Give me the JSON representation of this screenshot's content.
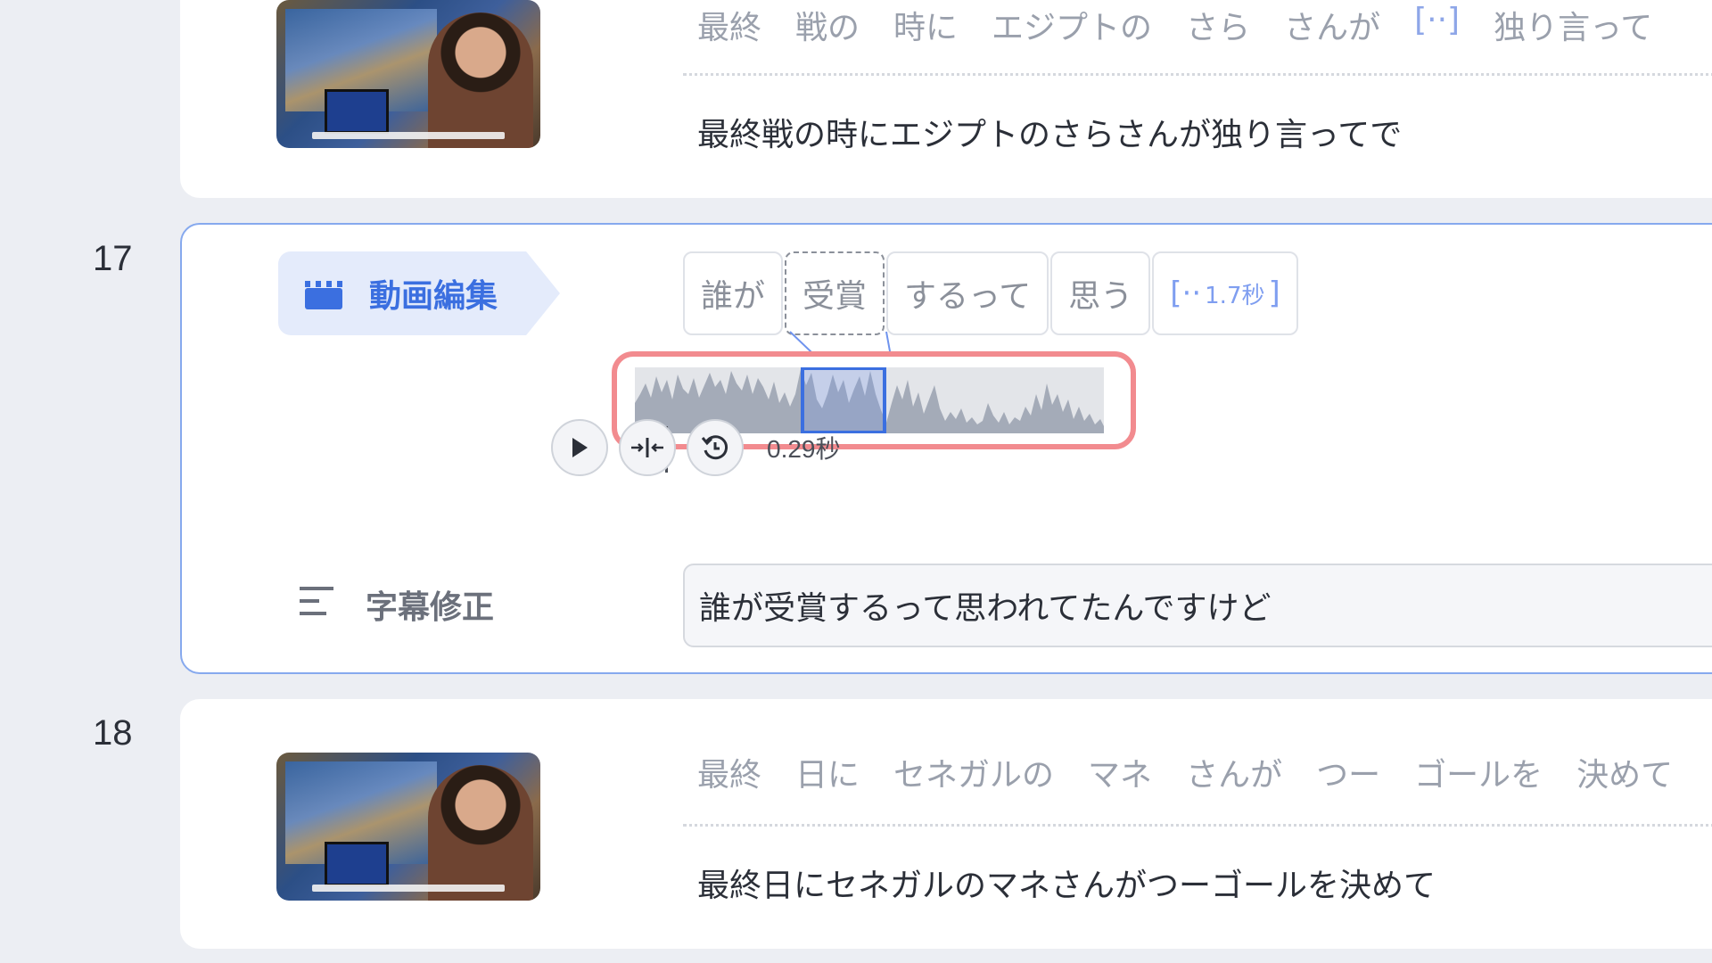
{
  "rows": [
    {
      "number": "",
      "words": [
        "最終",
        "戦の",
        "時に",
        "エジプトの",
        "さら",
        "さんが",
        "[··]",
        "独り言って"
      ],
      "sentence": "最終戦の時にエジプトのさらさんが独り言ってで"
    },
    {
      "number": "17",
      "mode_label": "動画編集",
      "chips": [
        "誰が",
        "受賞",
        "するって",
        "思う"
      ],
      "gap_chip": {
        "prefix": "[··",
        "duration": "1.7秒",
        "suffix": "]"
      },
      "duration": "0.29秒",
      "subtitle_label": "字幕修正",
      "subtitle_value": "誰が受賞するって思われてたんですけど"
    },
    {
      "number": "18",
      "words": [
        "最終",
        "日に",
        "セネガルの",
        "マネ",
        "さんが",
        "つー",
        "ゴールを",
        "決めて"
      ],
      "sentence": "最終日にセネガルのマネさんがつーゴールを決めて"
    }
  ],
  "colors": {
    "accent": "#3b6fe0",
    "highlight_box": "#f28b8f",
    "background": "#eceef3"
  },
  "icons": {
    "play": "play-icon",
    "split": "split-icon",
    "reset": "reset-icon",
    "clapper": "clapperboard-icon",
    "subtitle": "subtitle-lines-icon"
  }
}
